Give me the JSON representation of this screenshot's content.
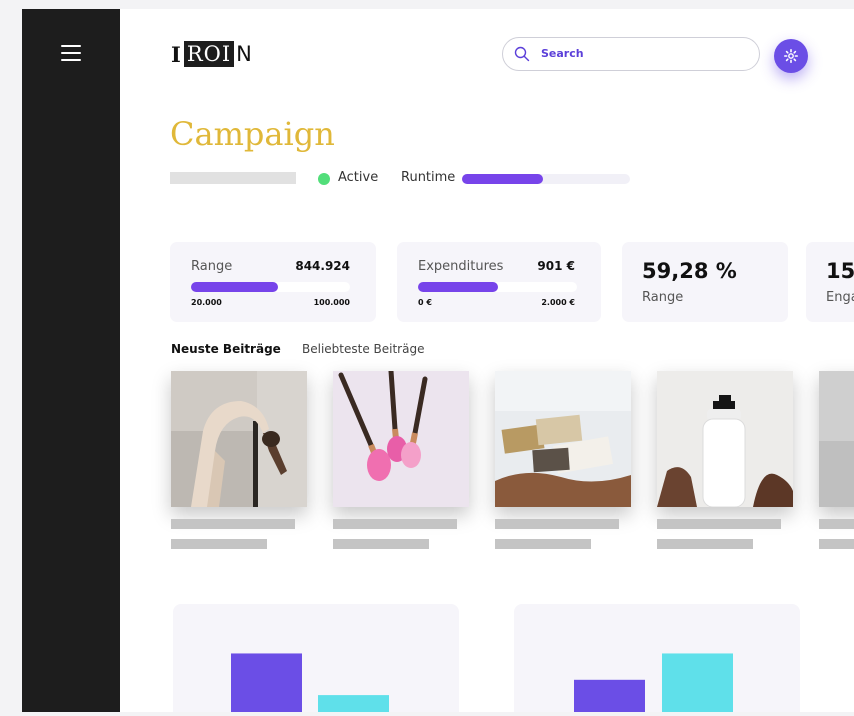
{
  "header": {
    "logo_left": "I",
    "logo_box": "ROI",
    "logo_right": "N",
    "search_placeholder": "Search"
  },
  "campaign": {
    "title": "Campaign",
    "status": "Active",
    "runtime_label": "Runtime",
    "runtime_progress": 0.48
  },
  "stats": [
    {
      "label": "Range",
      "value": "844.924",
      "min": "20.000",
      "max": "100.000",
      "progress": 0.55
    },
    {
      "label": "Expenditures",
      "value": "901 €",
      "min": "0 €",
      "max": "2.000 €",
      "progress": 0.5
    }
  ],
  "kpis": [
    {
      "value": "59,28 %",
      "label": "Range"
    },
    {
      "value": "15,",
      "label": "Enga"
    }
  ],
  "tabs": [
    "Neuste Beiträge",
    "Beliebteste Beiträge"
  ],
  "colors": {
    "accent": "#7744ea",
    "title": "#e0b839",
    "active": "#52de7a",
    "bar_purple": "#6b4ee6",
    "bar_cyan": "#5fe0ea"
  },
  "charts": [
    {
      "values": [
        0.83,
        0.34
      ]
    },
    {
      "values": [
        0.52,
        0.83
      ]
    }
  ]
}
